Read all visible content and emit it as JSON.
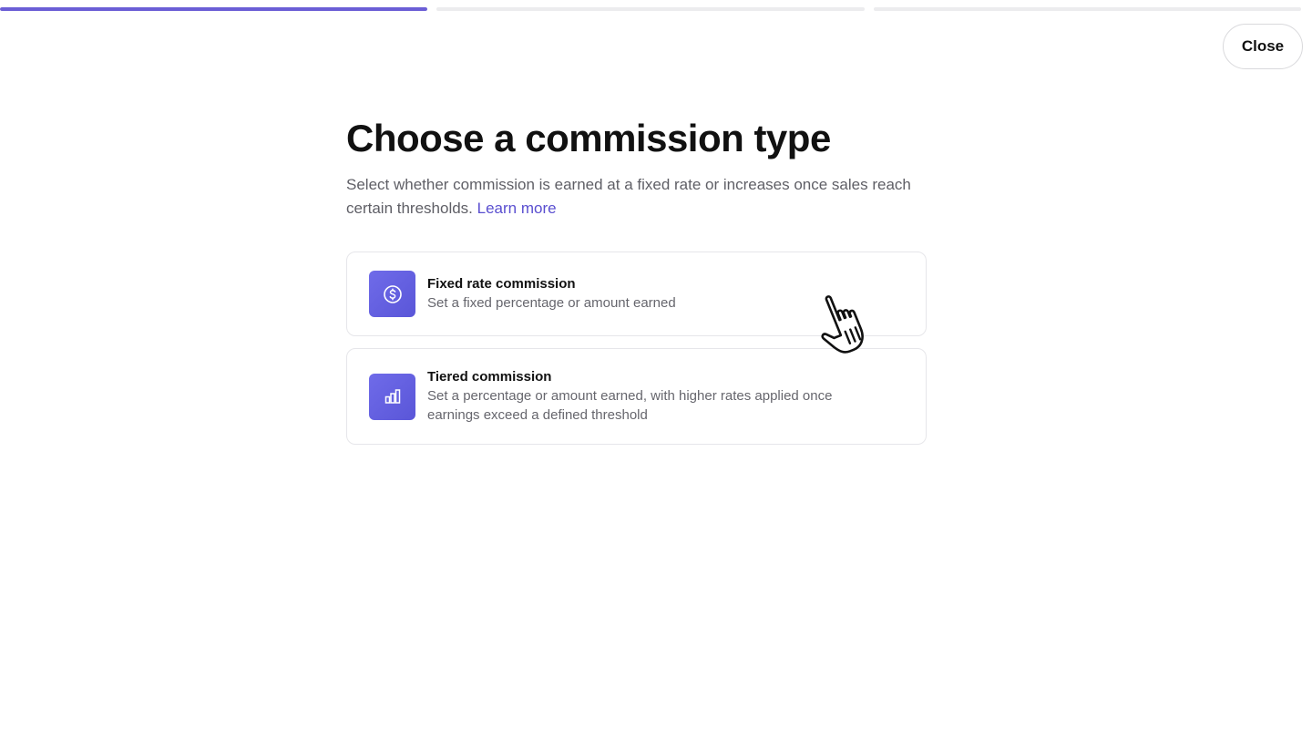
{
  "progress": {
    "steps": [
      {
        "fill_percent": 100
      },
      {
        "fill_percent": 0
      },
      {
        "fill_percent": 0
      }
    ],
    "accent_color": "#6b5ed6"
  },
  "header": {
    "close_label": "Close"
  },
  "main": {
    "title": "Choose a commission type",
    "subtitle": "Select whether commission is earned at a fixed rate or increases once sales reach certain thresholds.",
    "learn_more_label": "Learn more"
  },
  "options": [
    {
      "title": "Fixed rate commission",
      "description": "Set a fixed percentage or amount earned",
      "icon": "dollar-circle-icon"
    },
    {
      "title": "Tiered commission",
      "description": "Set a percentage or amount earned, with higher rates applied once earnings exceed a defined threshold",
      "icon": "bar-chart-icon"
    }
  ],
  "cursor": {
    "icon": "hand-pointer-icon"
  }
}
